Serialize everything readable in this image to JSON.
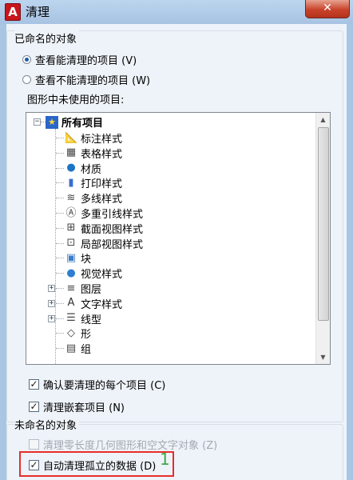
{
  "title_bar": {
    "app_icon": "A",
    "title": "清理",
    "close": "✕"
  },
  "named_objects": {
    "group_title": "已命名的对象",
    "radio_purgeable": "查看能清理的项目 (V)",
    "radio_nonpurgeable": "查看不能清理的项目 (W)",
    "tree_label": "图形中未使用的项目:",
    "tree": {
      "root_label": "所有项目",
      "items": [
        {
          "label": "标注样式",
          "icon": "dimension-style-icon",
          "expandable": false
        },
        {
          "label": "表格样式",
          "icon": "table-style-icon",
          "expandable": false
        },
        {
          "label": "材质",
          "icon": "material-icon",
          "expandable": false
        },
        {
          "label": "打印样式",
          "icon": "plot-style-icon",
          "expandable": false
        },
        {
          "label": "多线样式",
          "icon": "multiline-style-icon",
          "expandable": false
        },
        {
          "label": "多重引线样式",
          "icon": "multileader-style-icon",
          "expandable": false
        },
        {
          "label": "截面视图样式",
          "icon": "section-view-style-icon",
          "expandable": false
        },
        {
          "label": "局部视图样式",
          "icon": "detail-view-style-icon",
          "expandable": false
        },
        {
          "label": "块",
          "icon": "block-icon",
          "expandable": false
        },
        {
          "label": "视觉样式",
          "icon": "visual-style-icon",
          "expandable": false
        },
        {
          "label": "图层",
          "icon": "layer-icon",
          "expandable": true
        },
        {
          "label": "文字样式",
          "icon": "text-style-icon",
          "expandable": true
        },
        {
          "label": "线型",
          "icon": "linetype-icon",
          "expandable": true
        },
        {
          "label": "形",
          "icon": "shape-icon",
          "expandable": false
        },
        {
          "label": "组",
          "icon": "group-icon",
          "expandable": false
        }
      ]
    },
    "confirm_each": "确认要清理的每个项目 (C)",
    "purge_nested": "清理嵌套项目 (N)"
  },
  "unnamed_objects": {
    "group_title": "未命名的对象",
    "purge_zero_length": "清理零长度几何图形和空文字对象 (Z)",
    "auto_purge_orphaned": "自动清理孤立的数据 (D)"
  },
  "annotation": {
    "number": "1"
  }
}
